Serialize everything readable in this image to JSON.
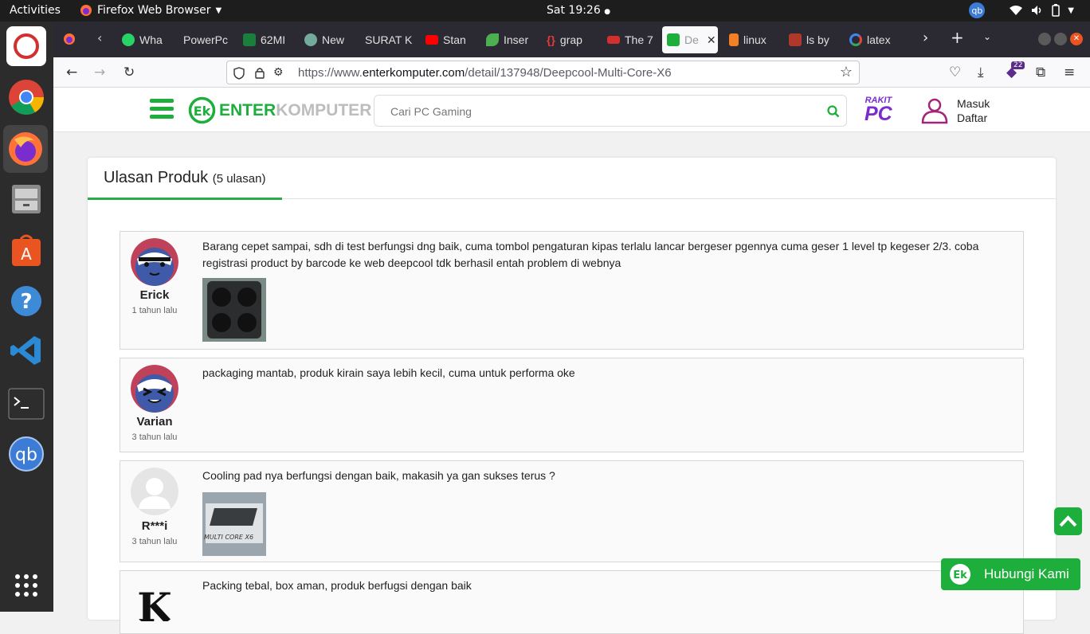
{
  "system_bar": {
    "activities": "Activities",
    "app_name": "Firefox Web Browser",
    "clock": "Sat 19:26",
    "tray_qb": "qb"
  },
  "tabs": [
    {
      "label": "Wha",
      "icon": "whatsapp-icon",
      "color": "#25d366"
    },
    {
      "label": "PowerPc",
      "icon": "none",
      "color": ""
    },
    {
      "label": "62MI",
      "icon": "plus-icon",
      "color": "#1a7f3c"
    },
    {
      "label": "New",
      "icon": "chatgpt-icon",
      "color": "#74aa9c"
    },
    {
      "label": "SURAT K",
      "icon": "none",
      "color": ""
    },
    {
      "label": "Stan",
      "icon": "youtube-icon",
      "color": "#ff0000"
    },
    {
      "label": "Inser",
      "icon": "leaf-icon",
      "color": "#4caf50"
    },
    {
      "label": "grap",
      "icon": "braces-icon",
      "color": "#e53935"
    },
    {
      "label": "The 7",
      "icon": "red-logo-icon",
      "color": "#d32f2f"
    },
    {
      "label": "De",
      "icon": "enterkomputer-icon",
      "color": "#1dae3c",
      "active": true
    },
    {
      "label": "linux",
      "icon": "stack-icon",
      "color": "#f48024"
    },
    {
      "label": "ls by",
      "icon": "ls-icon",
      "color": "#b0382b"
    },
    {
      "label": "latex",
      "icon": "google-icon",
      "color": "#4285f4"
    }
  ],
  "address_bar": {
    "url_prefix": "https://www.",
    "url_domain": "enterkomputer.com",
    "url_path": "/detail/137948/Deepcool-Multi-Core-X6"
  },
  "extensions_badge": "22",
  "site": {
    "logo_enter": "ENTER",
    "logo_komputer": "KOMPUTER",
    "search_placeholder": "Cari PC Gaming",
    "rakit_top": "RAKIT",
    "rakit_bottom": "PC",
    "login": "Masuk",
    "register": "Daftar"
  },
  "reviews_section": {
    "title": "Ulasan Produk",
    "count": "(5 ulasan)"
  },
  "reviews": [
    {
      "name": "Erick",
      "time": "1 tahun lalu",
      "text": "Barang cepet sampai, sdh di test berfungsi dng baik, cuma tombol pengaturan kipas terlalu lancar bergeser pgennya cuma geser 1 level tp kegeser 2/3. coba registrasi product by barcode ke web deepcool tdk berhasil entah problem di webnya",
      "has_photo": true
    },
    {
      "name": "Varian",
      "time": "3 tahun lalu",
      "text": "packaging mantab, produk kirain saya lebih kecil, cuma untuk performa oke",
      "has_photo": false
    },
    {
      "name": "R***i",
      "time": "3 tahun lalu",
      "text": "Cooling pad nya berfungsi dengan baik, makasih ya gan sukses terus ?",
      "has_photo": true,
      "photo_caption": "MULTI CORE X6"
    },
    {
      "name": "",
      "time": "",
      "text": "Packing tebal, box aman, produk berfugsi dengan baik",
      "has_photo": false
    }
  ],
  "contact_button": "Hubungi Kami"
}
